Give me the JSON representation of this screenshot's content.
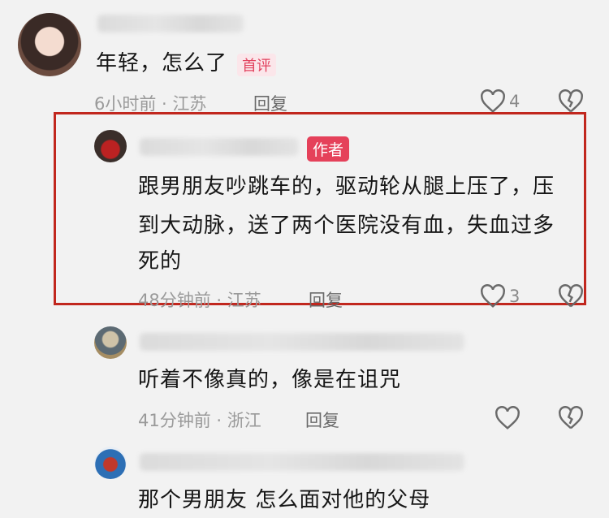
{
  "comments": [
    {
      "text": "年轻，怎么了",
      "badge": "首评",
      "meta": "6小时前 · 江苏",
      "reply": "回复",
      "likes": "4"
    },
    {
      "badge": "作者",
      "text_lines": [
        "跟男朋友吵跳车的，驱动轮从腿上压了，压",
        "到大动脉，送了两个医院没有血，失血过多",
        "死的"
      ],
      "meta": "48分钟前 · 江苏",
      "reply": "回复",
      "likes": "3",
      "highlighted": true,
      "highlight_color": "#c1271e"
    },
    {
      "text": "听着不像真的，像是在诅咒",
      "meta": "41分钟前 · 浙江",
      "reply": "回复"
    },
    {
      "text": "那个男朋友 怎么面对他的父母"
    }
  ],
  "colors": {
    "author_badge": "#e5415a",
    "first_badge": "#e2435f",
    "meta": "#9a9a9a"
  }
}
